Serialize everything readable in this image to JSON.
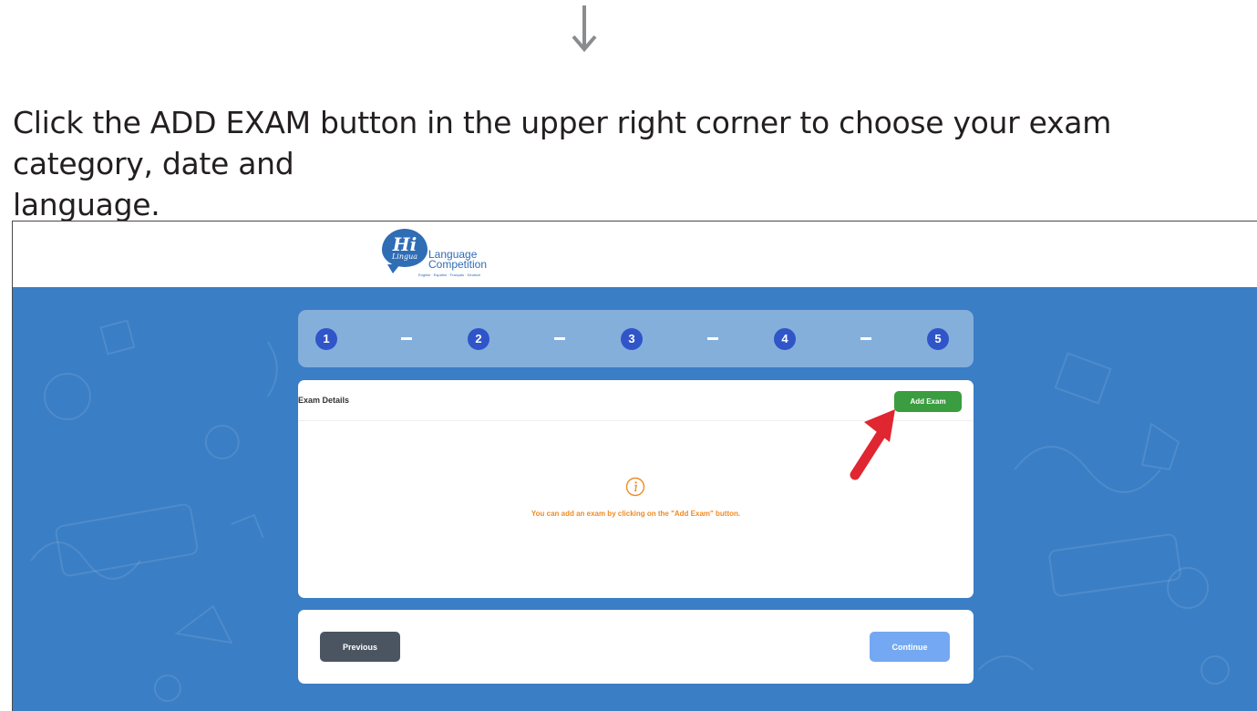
{
  "instruction": {
    "line1": "Click the ADD EXAM button in the upper right corner to choose your exam category, date and",
    "line2": "language."
  },
  "logo": {
    "hi": "Hi",
    "lingua": "Lingua",
    "text_line1": "Language",
    "text_line2": "Competition",
    "subtitle": "English · Español · Français · Deutsch"
  },
  "steps": [
    "1",
    "2",
    "3",
    "4",
    "5"
  ],
  "exam_card": {
    "title": "Exam Details",
    "add_button": "Add Exam",
    "empty_message": "You can add an exam by clicking on the \"Add Exam\" button."
  },
  "nav": {
    "previous": "Previous",
    "continue": "Continue"
  },
  "colors": {
    "background_blue": "#3a7ec5",
    "step_circle": "#2f55c8",
    "add_exam_green": "#3a9d3f",
    "message_orange": "#f08a24",
    "previous_gray": "#4b5561",
    "continue_blue": "#74a8f2",
    "pointer_red": "#e02630"
  }
}
